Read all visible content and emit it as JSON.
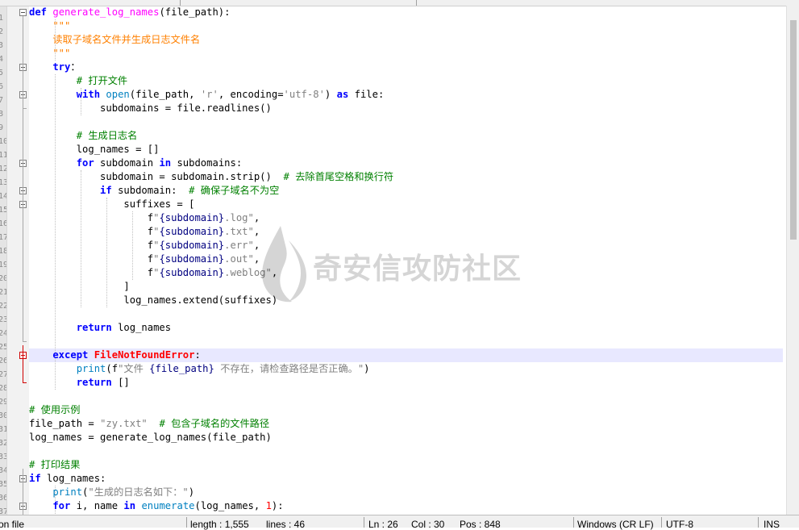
{
  "editor": {
    "lines": [
      [
        [
          "kw",
          "def "
        ],
        [
          "fn",
          "generate_log_names"
        ],
        [
          "",
          "(file_path):"
        ]
      ],
      [
        [
          "ds",
          "    \"\"\""
        ]
      ],
      [
        [
          "ds",
          "    读取子域名文件并生成日志文件名"
        ]
      ],
      [
        [
          "ds",
          "    \"\"\""
        ]
      ],
      [
        [
          "kw",
          "    try"
        ],
        [
          "",
          "："
        ]
      ],
      [
        [
          "cm",
          "        # 打开文件"
        ]
      ],
      [
        [
          "kw",
          "        with "
        ],
        [
          "bi",
          "open"
        ],
        [
          "",
          "(file_path, "
        ],
        [
          "str",
          "'r'"
        ],
        [
          "",
          ", encoding="
        ],
        [
          "str",
          "'utf-8'"
        ],
        [
          "",
          ") "
        ],
        [
          "kw",
          "as"
        ],
        [
          "",
          " file:"
        ]
      ],
      [
        [
          "",
          "            subdomains = file.readlines()"
        ]
      ],
      [
        [
          "",
          ""
        ]
      ],
      [
        [
          "cm",
          "        # 生成日志名"
        ]
      ],
      [
        [
          "",
          "        log_names = []"
        ]
      ],
      [
        [
          "kw",
          "        for"
        ],
        [
          "",
          " subdomain "
        ],
        [
          "kw",
          "in"
        ],
        [
          "",
          " subdomains:"
        ]
      ],
      [
        [
          "",
          "            subdomain = subdomain.strip()  "
        ],
        [
          "cm",
          "# 去除首尾空格和换行符"
        ]
      ],
      [
        [
          "kw",
          "            if"
        ],
        [
          "",
          " subdomain:  "
        ],
        [
          "cm",
          "# 确保子域名不为空"
        ]
      ],
      [
        [
          "",
          "                suffixes = ["
        ]
      ],
      [
        [
          "",
          "                    f"
        ],
        [
          "str",
          "\""
        ],
        [
          "vbr",
          "{subdomain}"
        ],
        [
          "str",
          ".log\""
        ],
        [
          "",
          ","
        ]
      ],
      [
        [
          "",
          "                    f"
        ],
        [
          "str",
          "\""
        ],
        [
          "vbr",
          "{subdomain}"
        ],
        [
          "str",
          ".txt\""
        ],
        [
          "",
          ","
        ]
      ],
      [
        [
          "",
          "                    f"
        ],
        [
          "str",
          "\""
        ],
        [
          "vbr",
          "{subdomain}"
        ],
        [
          "str",
          ".err\""
        ],
        [
          "",
          ","
        ]
      ],
      [
        [
          "",
          "                    f"
        ],
        [
          "str",
          "\""
        ],
        [
          "vbr",
          "{subdomain}"
        ],
        [
          "str",
          ".out\""
        ],
        [
          "",
          ","
        ]
      ],
      [
        [
          "",
          "                    f"
        ],
        [
          "str",
          "\""
        ],
        [
          "vbr",
          "{subdomain}"
        ],
        [
          "str",
          ".weblog\""
        ],
        [
          "",
          ","
        ]
      ],
      [
        [
          "",
          "                ]"
        ]
      ],
      [
        [
          "",
          "                log_names.extend(suffixes)"
        ]
      ],
      [
        [
          "",
          ""
        ]
      ],
      [
        [
          "kw",
          "        return"
        ],
        [
          "",
          " log_names"
        ]
      ],
      [
        [
          "",
          ""
        ]
      ],
      [
        [
          "kw",
          "    except "
        ],
        [
          "ex",
          "FileNotFoundError"
        ],
        [
          "",
          ":"
        ]
      ],
      [
        [
          "bi",
          "        print"
        ],
        [
          "",
          "(f"
        ],
        [
          "str",
          "\"文件 "
        ],
        [
          "vbr",
          "{file_path}"
        ],
        [
          "str",
          " 不存在，请检查路径是否正确。\""
        ],
        [
          "",
          ")"
        ]
      ],
      [
        [
          "kw",
          "        return"
        ],
        [
          "",
          " []"
        ]
      ],
      [
        [
          "",
          ""
        ]
      ],
      [
        [
          "cm",
          "# 使用示例"
        ]
      ],
      [
        [
          "",
          "file_path = "
        ],
        [
          "str",
          "\"zy.txt\""
        ],
        [
          "",
          "  "
        ],
        [
          "cm",
          "# 包含子域名的文件路径"
        ]
      ],
      [
        [
          "",
          "log_names = generate_log_names(file_path)"
        ]
      ],
      [
        [
          "",
          ""
        ]
      ],
      [
        [
          "cm",
          "# 打印结果"
        ]
      ],
      [
        [
          "kw",
          "if"
        ],
        [
          "",
          " log_names:"
        ]
      ],
      [
        [
          "bi",
          "    print"
        ],
        [
          "",
          "("
        ],
        [
          "str",
          "\"生成的日志名如下：\""
        ],
        [
          "",
          ")"
        ]
      ],
      [
        [
          "kw",
          "    for"
        ],
        [
          "",
          " i, name "
        ],
        [
          "kw",
          "in"
        ],
        [
          "",
          " "
        ],
        [
          "bi",
          "enumerate"
        ],
        [
          "",
          "(log_names, "
        ],
        [
          "num",
          "1"
        ],
        [
          "",
          "):"
        ]
      ]
    ]
  },
  "watermark": {
    "text": "奇安信攻防社区"
  },
  "statusbar": {
    "file_type": "on file",
    "length": "length : 1,555",
    "lines": "lines : 46",
    "ln": "Ln : 26",
    "col": "Col : 30",
    "pos": "Pos : 848",
    "eol": "Windows (CR LF)",
    "encoding": "UTF-8",
    "mode": "INS"
  }
}
